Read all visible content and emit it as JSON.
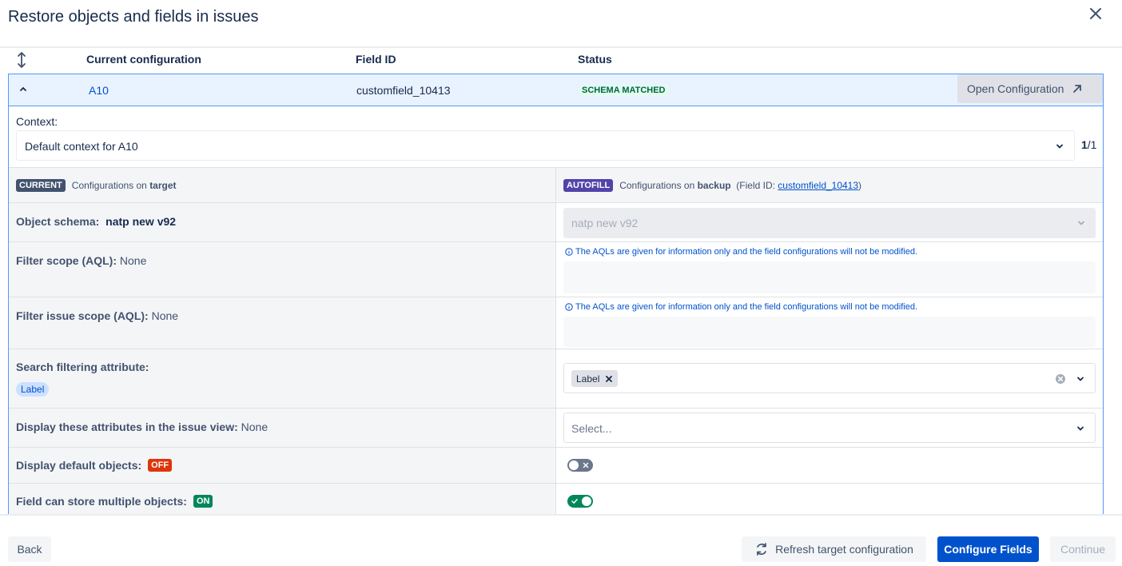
{
  "modal": {
    "title": "Restore objects and fields in issues"
  },
  "table": {
    "headers": {
      "current_configuration": "Current configuration",
      "field_id": "Field ID",
      "status": "Status"
    },
    "row": {
      "name": "A10",
      "field_id": "customfield_10413",
      "status": "SCHEMA MATCHED",
      "open_button": "Open Configuration"
    }
  },
  "context": {
    "label": "Context:",
    "value": "Default context for A10",
    "pager_current": "1",
    "pager_total": "/1"
  },
  "columns": {
    "left_badge": "CURRENT",
    "left_prefix": "Configurations on ",
    "left_strong": "target",
    "right_badge": "AUTOFILL",
    "right_prefix": "Configurations on ",
    "right_strong": "backup",
    "right_fieldid_prefix": "(Field ID: ",
    "right_fieldid_link": "customfield_10413",
    "right_fieldid_suffix": ")"
  },
  "rows": {
    "object_schema": {
      "label": "Object schema:",
      "value": "natp new v92",
      "backup_value": "natp new v92"
    },
    "filter_scope": {
      "label": "Filter scope (AQL):",
      "value": "None",
      "note": "The AQLs are given for information only and the field configurations will not be modified."
    },
    "filter_issue_scope": {
      "label": "Filter issue scope (AQL):",
      "value": "None",
      "note": "The AQLs are given for information only and the field configurations will not be modified."
    },
    "search_filtering": {
      "label": "Search filtering attribute:",
      "chip": "Label",
      "tag": "Label"
    },
    "display_attributes": {
      "label": "Display these attributes in the issue view:",
      "value": "None",
      "placeholder": "Select..."
    },
    "display_default": {
      "label": "Display default objects:",
      "badge": "OFF"
    },
    "multiple_objects": {
      "label": "Field can store multiple objects:",
      "badge": "ON"
    }
  },
  "toggles": {
    "display_default_on": false,
    "multiple_objects_on": true
  },
  "footer": {
    "back": "Back",
    "refresh": "Refresh target configuration",
    "configure": "Configure Fields",
    "continue": "Continue"
  },
  "colors": {
    "primary": "#0052cc",
    "success": "#00875a",
    "danger": "#de350b",
    "purple": "#5243aa",
    "selected_row": "#e9f2ff"
  }
}
